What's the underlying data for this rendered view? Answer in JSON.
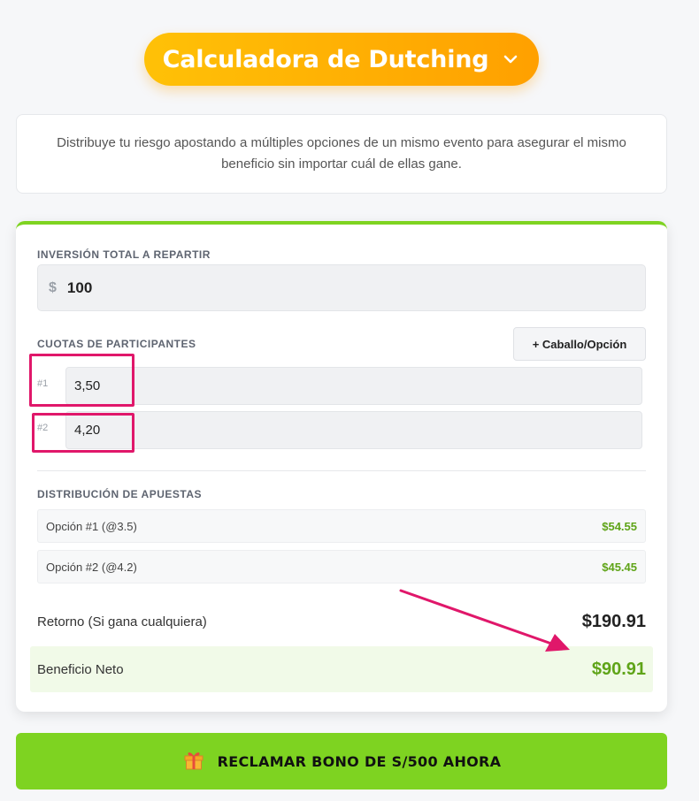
{
  "header": {
    "title": "Calculadora de Dutching",
    "chevron_icon": "chevron-down-icon"
  },
  "description": "Distribuye tu riesgo apostando a múltiples opciones de un mismo evento para asegurar el mismo beneficio sin importar cuál de ellas gane.",
  "investment": {
    "label": "Inversión total a repartir",
    "currency_symbol": "$",
    "value": "100"
  },
  "odds": {
    "label": "Cuotas de participantes",
    "add_button_label": "+ Caballo/Opción",
    "rows": [
      {
        "index": "#1",
        "value": "3,50"
      },
      {
        "index": "#2",
        "value": "4,20"
      }
    ]
  },
  "distribution": {
    "label": "Distribución de apuestas",
    "rows": [
      {
        "option": "Opción #1 (@3.5)",
        "amount": "$54.55"
      },
      {
        "option": "Opción #2 (@4.2)",
        "amount": "$45.45"
      }
    ]
  },
  "results": {
    "return_label": "Retorno (Si gana cualquiera)",
    "return_value": "$190.91",
    "profit_label": "Beneficio Neto",
    "profit_value": "$90.91"
  },
  "cta": {
    "icon": "gift-icon",
    "label": "RECLAMAR BONO DE S/500 AHORA"
  },
  "colors": {
    "accent_orange": "#ffa000",
    "accent_green": "#7ed321",
    "value_green": "#5fa418",
    "highlight_pink": "#e0176a"
  }
}
